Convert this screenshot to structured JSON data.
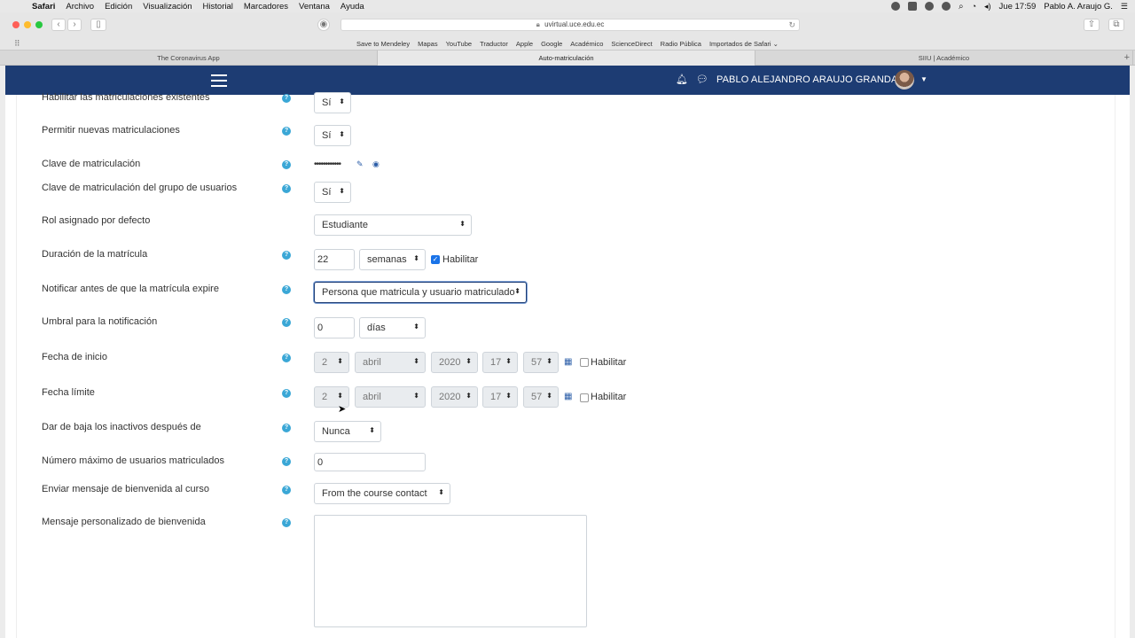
{
  "menubar": {
    "app": "Safari",
    "items": [
      "Archivo",
      "Edición",
      "Visualización",
      "Historial",
      "Marcadores",
      "Ventana",
      "Ayuda"
    ],
    "clock": "Jue 17:59",
    "user": "Pablo A. Araujo G."
  },
  "browser": {
    "url": "uvirtual.uce.edu.ec",
    "bookmarks": [
      "Save to Mendeley",
      "Mapas",
      "YouTube",
      "Traductor",
      "Apple",
      "Google",
      "Académico",
      "ScienceDirect",
      "Radio Pública",
      "Importados de Safari ⌄"
    ],
    "tabs": [
      "The Coronavirus App",
      "Auto-matriculación",
      "SIIU | Académico"
    ]
  },
  "navbar": {
    "user_name": "PABLO ALEJANDRO ARAUJO GRANDA",
    "icons": [
      "menu-icon",
      "bell-icon",
      "chat-icon",
      "caret-down-icon"
    ]
  },
  "form": {
    "existing_enrolments": {
      "label": "Habilitar las matriculaciones existentes",
      "value": "Sí"
    },
    "new_enrolments": {
      "label": "Permitir nuevas matriculaciones",
      "value": "Sí"
    },
    "enrolment_key": {
      "label": "Clave de matriculación",
      "value": "••••••••••••"
    },
    "group_key": {
      "label": "Clave de matriculación del grupo de usuarios",
      "value": "Sí"
    },
    "default_role": {
      "label": "Rol asignado por defecto",
      "value": "Estudiante"
    },
    "duration": {
      "label": "Duración de la matrícula",
      "value": "22",
      "unit": "semanas",
      "enable_label": "Habilitar"
    },
    "notify": {
      "label": "Notificar antes de que la matrícula expire",
      "value": "Persona que matricula y usuario matriculado"
    },
    "threshold": {
      "label": "Umbral para la notificación",
      "value": "0",
      "unit": "días"
    },
    "start_date": {
      "label": "Fecha de inicio",
      "day": "2",
      "month": "abril",
      "year": "2020",
      "hour": "17",
      "minute": "57",
      "enable_label": "Habilitar"
    },
    "end_date": {
      "label": "Fecha límite",
      "day": "2",
      "month": "abril",
      "year": "2020",
      "hour": "17",
      "minute": "57",
      "enable_label": "Habilitar"
    },
    "unenrol_inactive": {
      "label": "Dar de baja los inactivos después de",
      "value": "Nunca"
    },
    "max_users": {
      "label": "Número máximo de usuarios matriculados",
      "value": "0"
    },
    "welcome_message": {
      "label": "Enviar mensaje de bienvenida al curso",
      "value": "From the course contact"
    },
    "custom_welcome": {
      "label": "Mensaje personalizado de bienvenida",
      "value": ""
    }
  },
  "colors": {
    "navbar": "#1d3c73",
    "help": "#3aa7d6",
    "accent": "#1a73e8"
  }
}
